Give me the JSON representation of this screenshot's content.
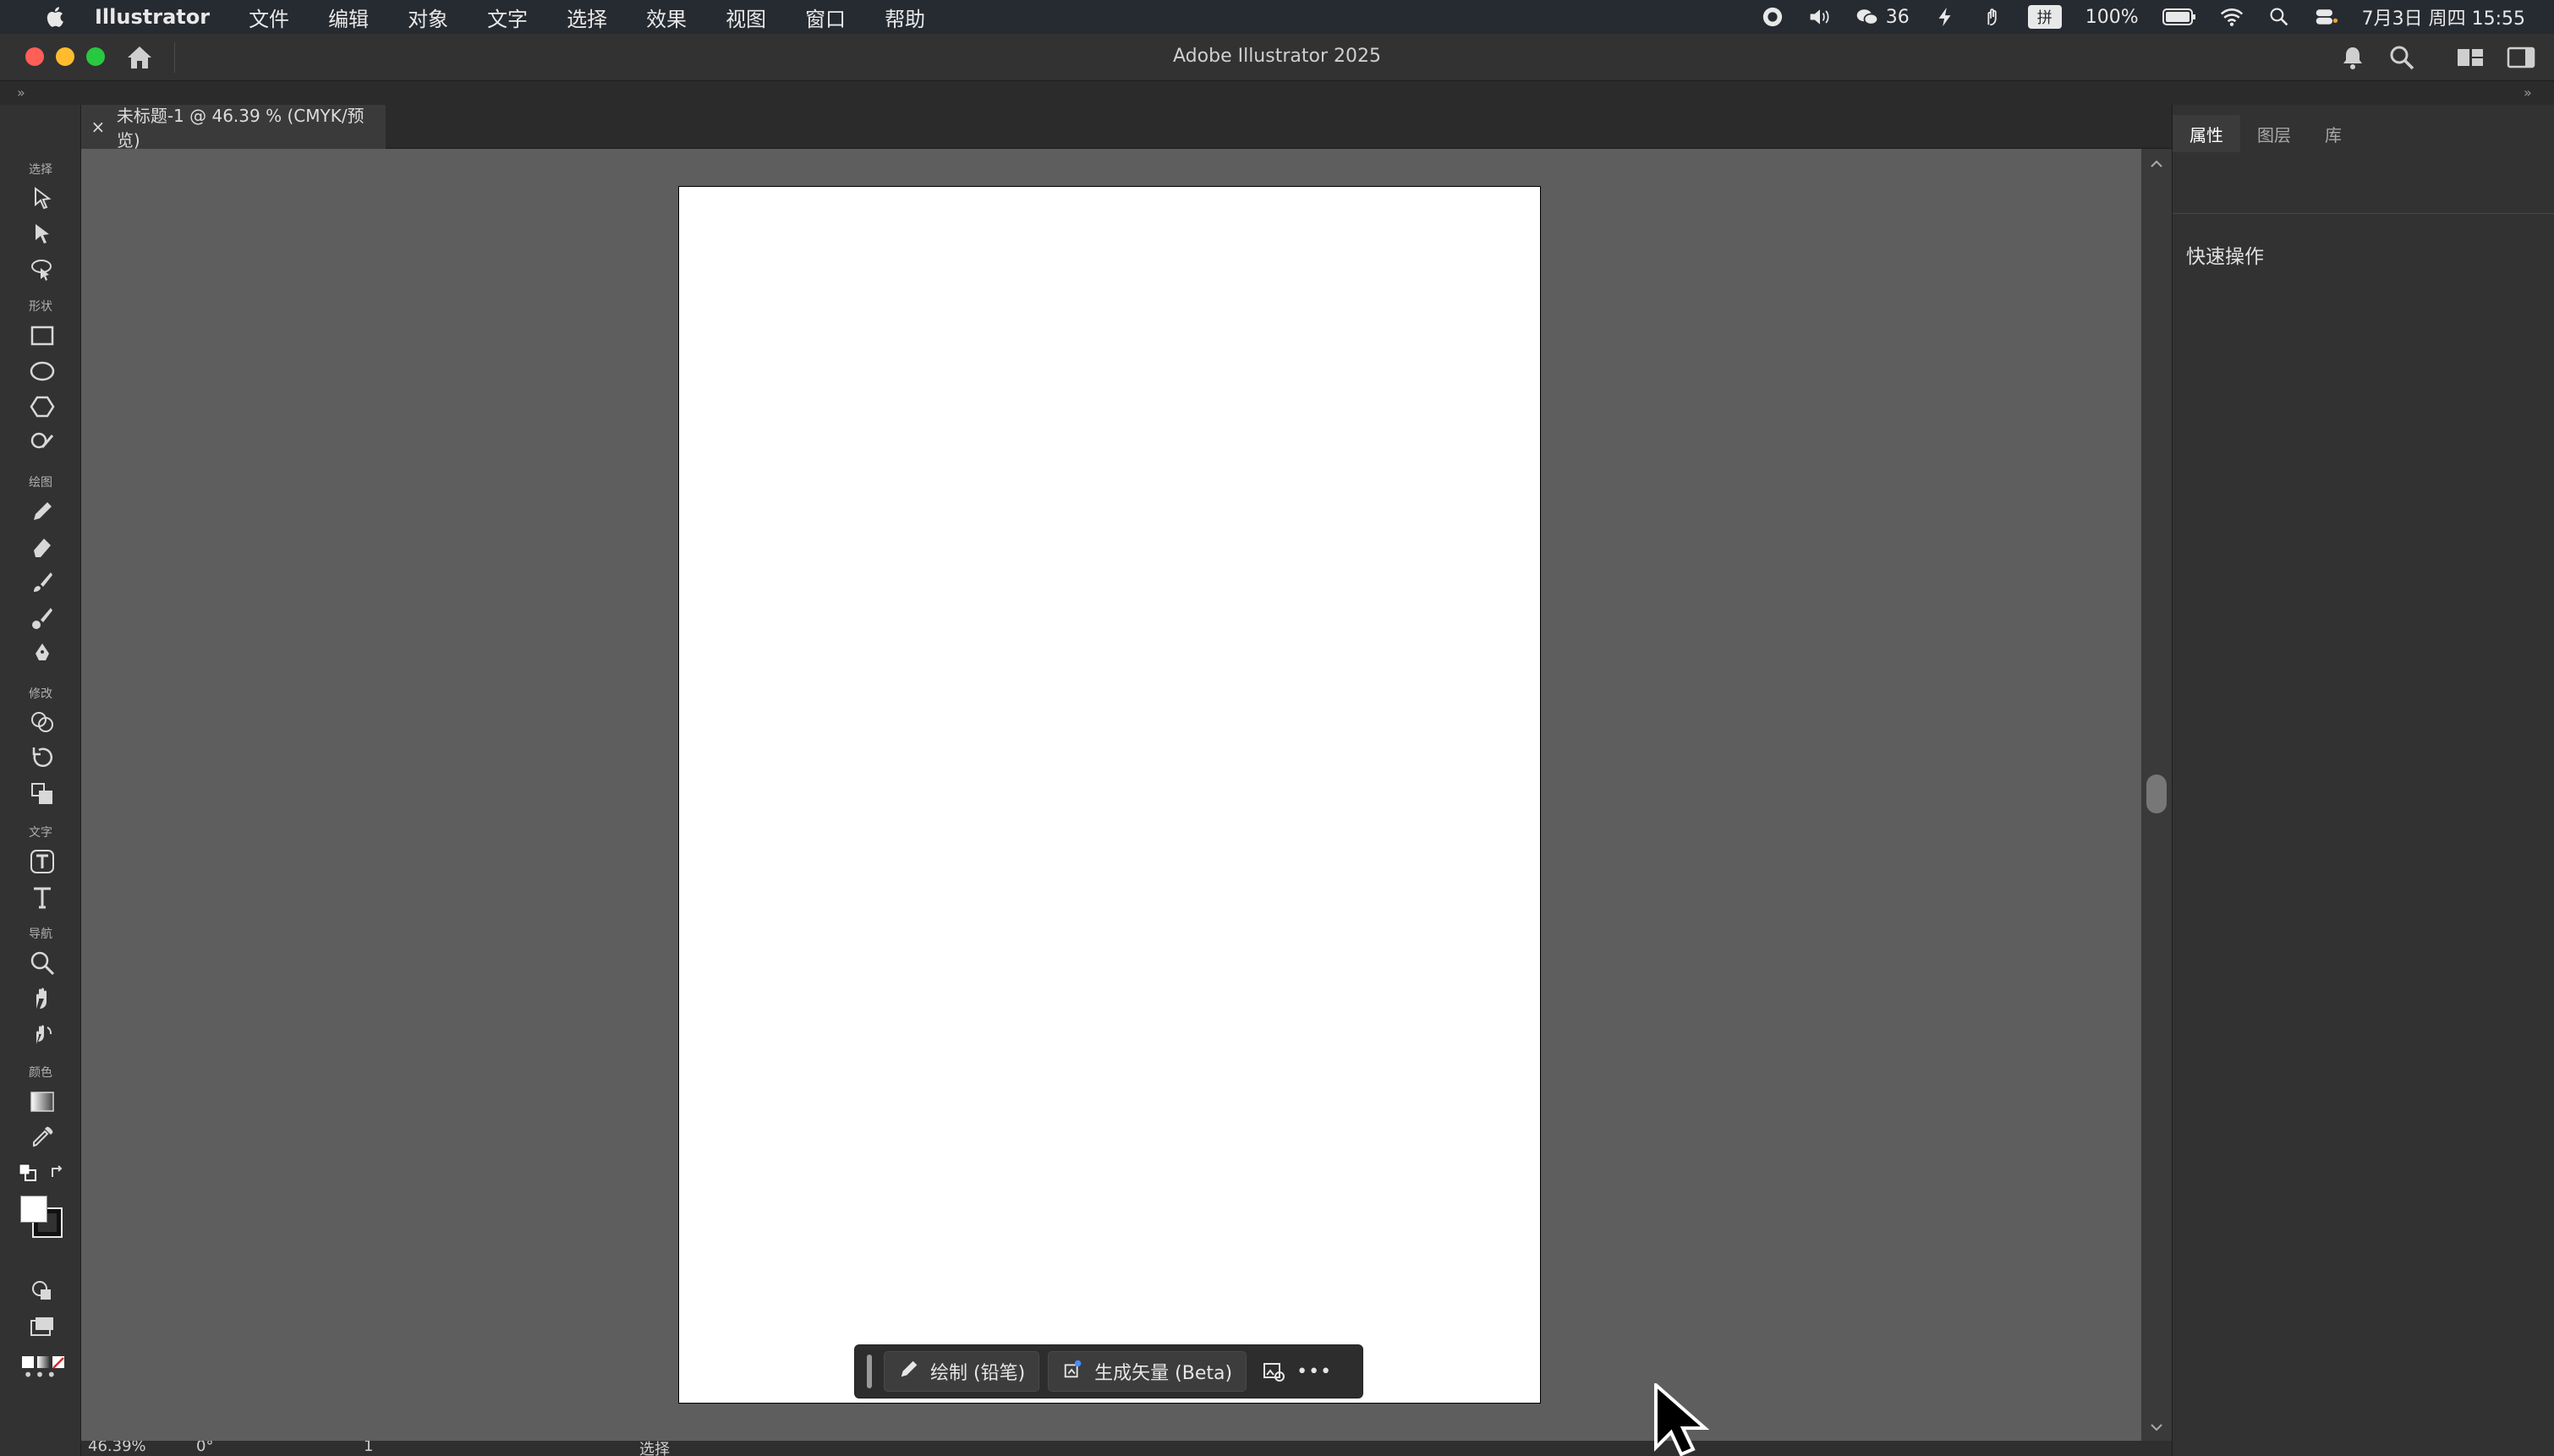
{
  "menubar": {
    "app_name": "Illustrator",
    "items": [
      "文件",
      "编辑",
      "对象",
      "文字",
      "选择",
      "效果",
      "视图",
      "窗口",
      "帮助"
    ],
    "wechat_count": "36",
    "input_method": "拼",
    "battery": "100%",
    "datetime": "7月3日 周四  15:55"
  },
  "window": {
    "title": "Adobe Illustrator 2025"
  },
  "document_tab": {
    "label": "未标题-1 @ 46.39 % (CMYK/预览)",
    "close": "×"
  },
  "toolbar": {
    "groups": {
      "select": "选择",
      "shape": "形状",
      "draw": "绘图",
      "modify": "修改",
      "type": "文字",
      "navigate": "导航",
      "color": "颜色"
    },
    "more": "•••"
  },
  "taskbar": {
    "draw_label": "绘制 (铅笔)",
    "vector_label": "生成矢量 (Beta)",
    "more": "•••"
  },
  "statusbar": {
    "zoom": "46.39%",
    "rotation": "0°",
    "artboard_index": "1",
    "mode": "选择"
  },
  "right_panel": {
    "tabs": [
      "属性",
      "图层",
      "库"
    ],
    "section_title": "快速操作"
  },
  "colors": {
    "canvas_bg": "#5e5e5e",
    "panel_bg": "#323232",
    "menubar_bg": "#262a31",
    "close_red": "#fe5f57",
    "minimize_yellow": "#febc2e",
    "zoom_green": "#28c840"
  }
}
